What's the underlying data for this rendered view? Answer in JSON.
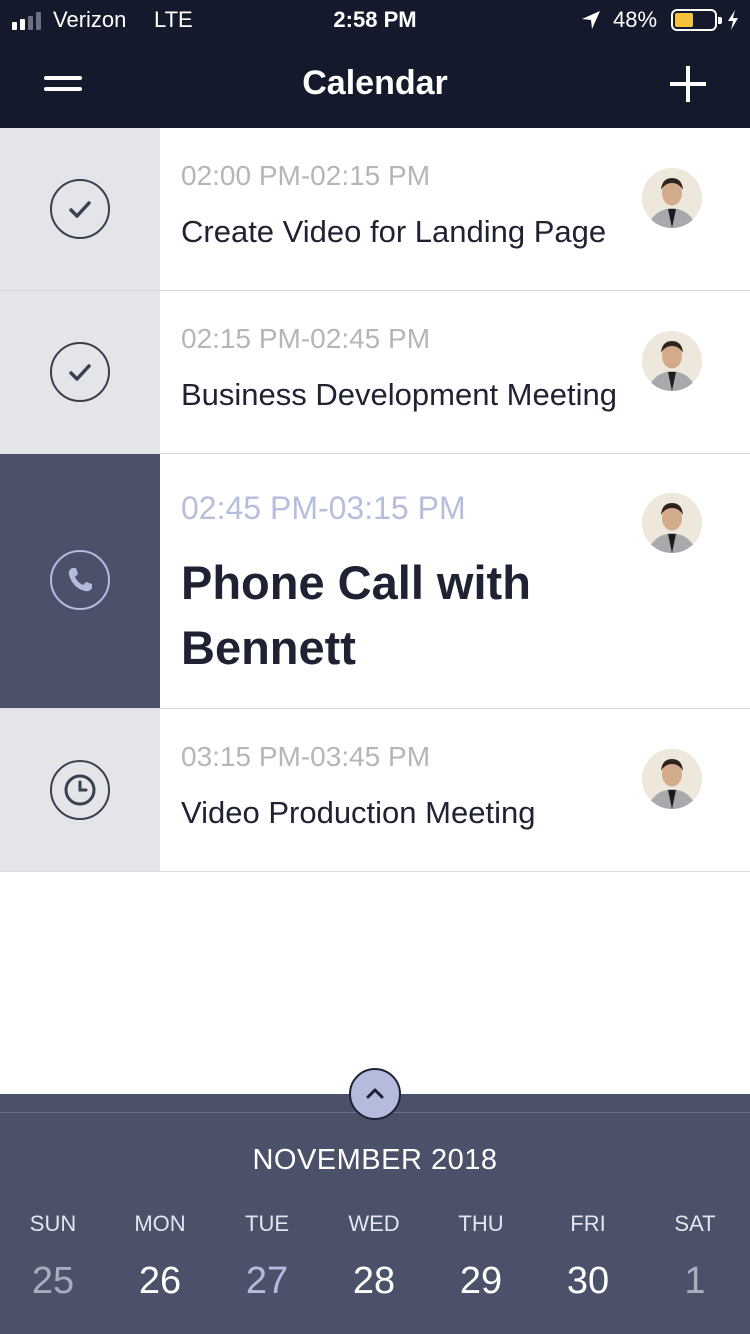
{
  "status_bar": {
    "carrier": "Verizon",
    "network": "LTE",
    "time": "2:58 PM",
    "battery_percent": "48%",
    "battery_level": 0.48,
    "battery_color": "#f5c33b"
  },
  "nav": {
    "title": "Calendar",
    "menu_icon": "hamburger-menu-icon",
    "add_icon": "plus-icon"
  },
  "events": [
    {
      "time": "02:00 PM-02:15 PM",
      "title": "Create Video for Landing Page",
      "icon": "check-circle-icon",
      "status": "done"
    },
    {
      "time": "02:15 PM-02:45 PM",
      "title": "Business Development Meeting",
      "icon": "check-circle-icon",
      "status": "done"
    },
    {
      "time": "02:45 PM-03:15 PM",
      "title": "Phone Call with Bennett",
      "icon": "phone-circle-icon",
      "status": "current"
    },
    {
      "time": "03:15 PM-03:45 PM",
      "title": "Video Production Meeting",
      "icon": "clock-circle-icon",
      "status": "upcoming"
    }
  ],
  "calendar": {
    "month": "NOVEMBER 2018",
    "toggle_icon": "chevron-up-icon",
    "weekdays": [
      "SUN",
      "MON",
      "TUE",
      "WED",
      "THU",
      "FRI",
      "SAT"
    ],
    "days": [
      "25",
      "26",
      "27",
      "28",
      "29",
      "30",
      "1"
    ],
    "selected_day": "27",
    "accent_color": "#b4bbdc",
    "background_color": "#4b5169"
  }
}
